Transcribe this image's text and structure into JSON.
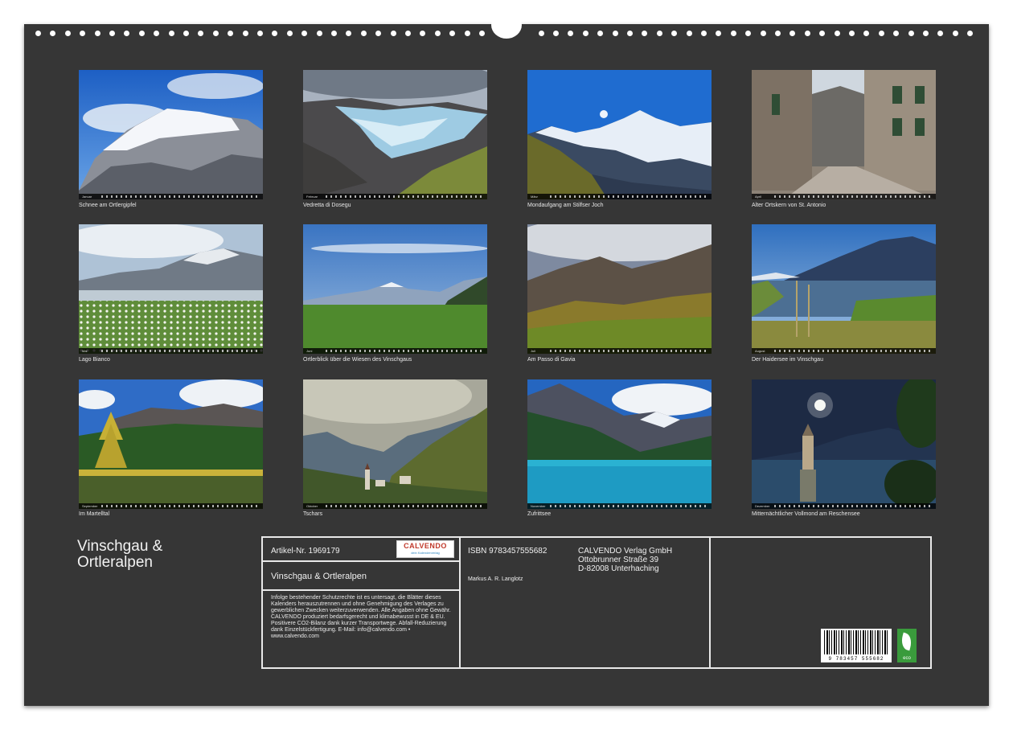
{
  "calendar": {
    "title_line1": "Vinschgau &",
    "title_line2": "Ortleralpen",
    "months": [
      {
        "strip_label": "Januar",
        "caption": "Schnee am Ortlergipfel",
        "scene": "alpine-summit"
      },
      {
        "strip_label": "Februar",
        "caption": "Vedretta di Dosegu",
        "scene": "glacier"
      },
      {
        "strip_label": "März",
        "caption": "Mondaufgang am Stilfser Joch",
        "scene": "moonrise"
      },
      {
        "strip_label": "April",
        "caption": "Alter Ortskern von St. Antonio",
        "scene": "village-street"
      },
      {
        "strip_label": "Mai",
        "caption": "Lago Bianco",
        "scene": "cotton-grass-lake"
      },
      {
        "strip_label": "Juni",
        "caption": "Ortlerblick über die Wiesen des Vinschgaus",
        "scene": "meadow"
      },
      {
        "strip_label": "Juli",
        "caption": "Am Passo di Gavia",
        "scene": "mountain-pass"
      },
      {
        "strip_label": "August",
        "caption": "Der Haidersee im Vinschgau",
        "scene": "reed-lake"
      },
      {
        "strip_label": "September",
        "caption": "Im Martelltal",
        "scene": "larch-forest"
      },
      {
        "strip_label": "Oktober",
        "caption": "Tschars",
        "scene": "village-valley"
      },
      {
        "strip_label": "November",
        "caption": "Zufrittsee",
        "scene": "turquoise-lake"
      },
      {
        "strip_label": "Dezember",
        "caption": "Mitternächtlicher Vollmond am Reschensee",
        "scene": "moonlit-tower"
      }
    ]
  },
  "info": {
    "article_no": "Artikel-Nr. 1969179",
    "logo_text": "CALVENDO",
    "logo_sub": "dein Kalenderverlag",
    "book_title": "Vinschgau & Ortleralpen",
    "isbn": "ISBN 9783457555682",
    "author": "Markus A. R. Langlotz",
    "publisher_line1": "CALVENDO Verlag GmbH",
    "publisher_line2": "Ottobrunner Straße 39",
    "publisher_line3": "D-82008 Unterhaching",
    "legal_text": "Infolge bestehender Schutzrechte ist es untersagt, die Blätter dieses Kalenders herauszutrennen und ohne Genehmigung des Verlages zu gewerblichen Zwecken weiterzuverwenden. Alle Angaben ohne Gewähr. CALVENDO produziert bedarfsgerecht und klimabewusst in DE & EU. Positivere CO2-Bilanz dank kurzer Transportwege. Abfall-Reduzierung dank Einzelstückfertigung. E-Mail: info@calvendo.com • www.calvendo.com",
    "barcode_number": "9 783457 555682",
    "eco_label": "eco"
  }
}
